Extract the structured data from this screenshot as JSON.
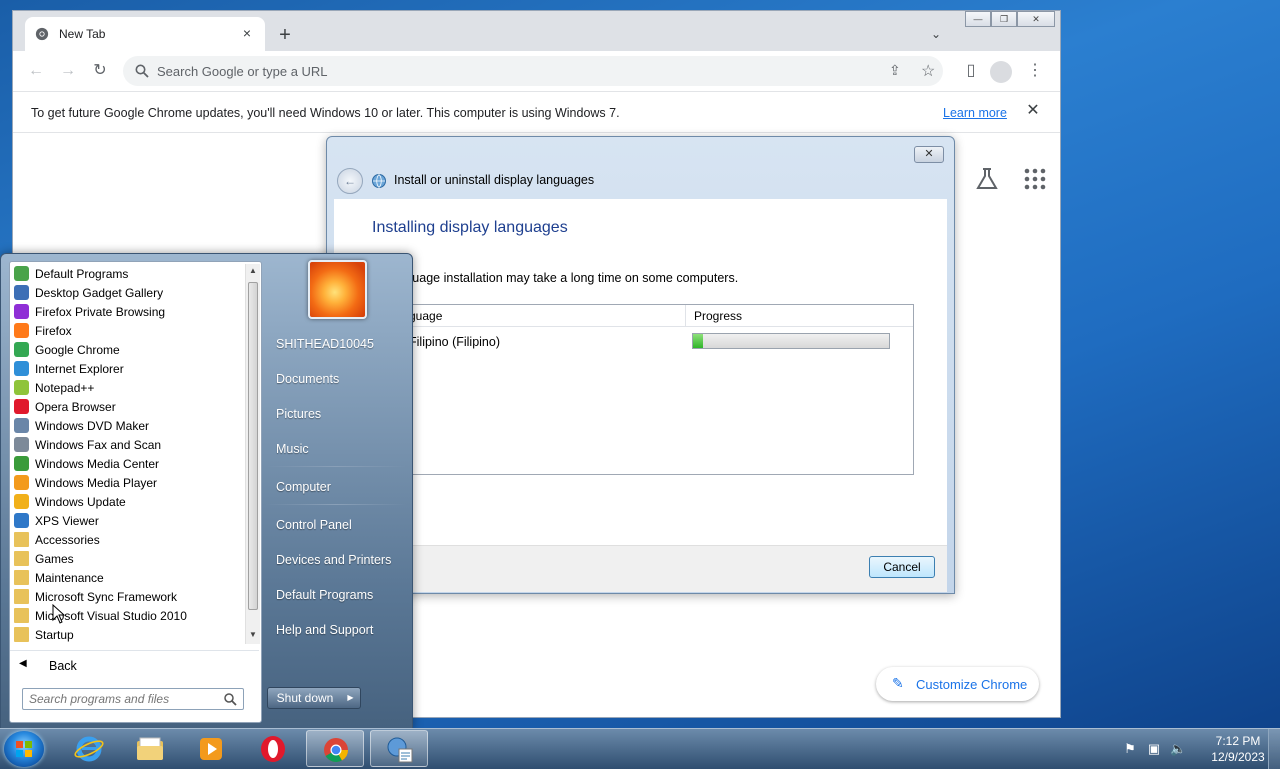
{
  "chrome": {
    "tab_title": "New Tab",
    "tab_close": "×",
    "new_tab": "+",
    "omnibox_placeholder": "Search Google or type a URL",
    "infobar_text": "To get future Google Chrome updates, you'll need Windows 10 or later. This computer is using Windows 7.",
    "learn_more": "Learn more",
    "infobar_close": "✕",
    "customize_label": "Customize Chrome",
    "window_controls": {
      "minimize": "—",
      "restore": "❐",
      "close": "✕"
    }
  },
  "dialog": {
    "title": "Install or uninstall display languages",
    "close": "✕",
    "heading": "Installing display languages",
    "description": "ay language installation may take a long time on some computers.",
    "columns": {
      "language": "guage",
      "progress": "Progress"
    },
    "rows": [
      {
        "language": "Filipino (Filipino)",
        "progress": 0.05
      }
    ],
    "cancel": "Cancel"
  },
  "start_menu": {
    "programs": [
      {
        "label": "Default Programs",
        "icon": "default-programs-icon",
        "color": "#4aa34a"
      },
      {
        "label": "Desktop Gadget Gallery",
        "icon": "gadget-icon",
        "color": "#3d6fb6"
      },
      {
        "label": "Firefox Private Browsing",
        "icon": "firefox-private-icon",
        "color": "#8f2fd6"
      },
      {
        "label": "Firefox",
        "icon": "firefox-icon",
        "color": "#ff7a1a"
      },
      {
        "label": "Google Chrome",
        "icon": "chrome-icon",
        "color": "#34a853"
      },
      {
        "label": "Internet Explorer",
        "icon": "ie-icon",
        "color": "#2f8fd8"
      },
      {
        "label": "Notepad++",
        "icon": "notepadpp-icon",
        "color": "#8fc43a"
      },
      {
        "label": "Opera Browser",
        "icon": "opera-icon",
        "color": "#e0192c"
      },
      {
        "label": "Windows DVD Maker",
        "icon": "dvd-maker-icon",
        "color": "#6a86a8"
      },
      {
        "label": "Windows Fax and Scan",
        "icon": "fax-scan-icon",
        "color": "#7d8a99"
      },
      {
        "label": "Windows Media Center",
        "icon": "media-center-icon",
        "color": "#3a9b3a"
      },
      {
        "label": "Windows Media Player",
        "icon": "media-player-icon",
        "color": "#f39a1c"
      },
      {
        "label": "Windows Update",
        "icon": "windows-update-icon",
        "color": "#f1b01a"
      },
      {
        "label": "XPS Viewer",
        "icon": "xps-viewer-icon",
        "color": "#2f78c8"
      },
      {
        "label": "Accessories",
        "icon": "folder-icon",
        "color": "#e8c25a"
      },
      {
        "label": "Games",
        "icon": "folder-icon",
        "color": "#e8c25a"
      },
      {
        "label": "Maintenance",
        "icon": "folder-icon",
        "color": "#e8c25a"
      },
      {
        "label": "Microsoft Sync Framework",
        "icon": "folder-icon",
        "color": "#e8c25a"
      },
      {
        "label": "Microsoft Visual Studio 2010",
        "icon": "folder-icon",
        "color": "#e8c25a"
      },
      {
        "label": "Startup",
        "icon": "folder-icon",
        "color": "#e8c25a"
      }
    ],
    "back": "Back",
    "search_placeholder": "Search programs and files",
    "right_items": [
      {
        "label": "SHITHEAD10045"
      },
      {
        "label": "Documents"
      },
      {
        "label": "Pictures"
      },
      {
        "label": "Music"
      },
      {
        "label": "Computer"
      },
      {
        "label": "Control Panel"
      },
      {
        "label": "Devices and Printers"
      },
      {
        "label": "Default Programs"
      },
      {
        "label": "Help and Support"
      }
    ],
    "shutdown": "Shut down"
  },
  "taskbar": {
    "apps": [
      "internet-explorer",
      "windows-explorer",
      "media-player",
      "opera",
      "google-chrome",
      "language-installer"
    ],
    "time": "7:12 PM",
    "date": "12/9/2023"
  }
}
